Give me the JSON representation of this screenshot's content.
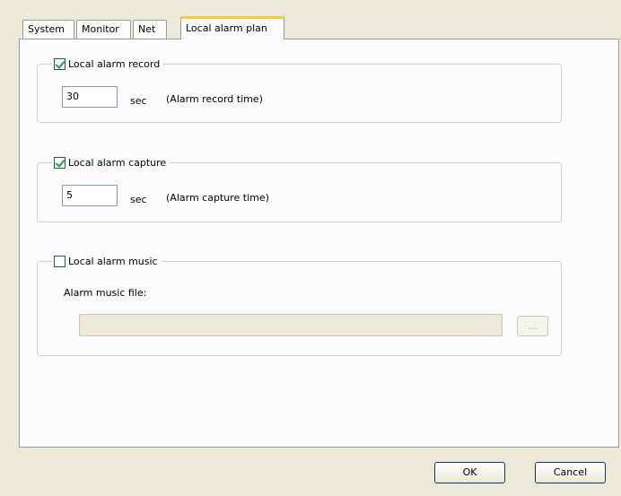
{
  "tabs": [
    {
      "label": "System"
    },
    {
      "label": "Monitor"
    },
    {
      "label": "Net"
    },
    {
      "label": "Local alarm plan",
      "active": true
    }
  ],
  "record": {
    "checkbox_label": "Local alarm record",
    "checked": true,
    "value": "30",
    "unit": "sec",
    "hint": "(Alarm record time)"
  },
  "capture": {
    "checkbox_label": "Local alarm capture",
    "checked": true,
    "value": "5",
    "unit": "sec",
    "hint": "(Alarm capture time)"
  },
  "music": {
    "checkbox_label": "Local alarm music",
    "checked": false,
    "file_label": "Alarm music file:",
    "file_value": "",
    "browse_label": "..."
  },
  "buttons": {
    "ok": "OK",
    "cancel": "Cancel"
  }
}
